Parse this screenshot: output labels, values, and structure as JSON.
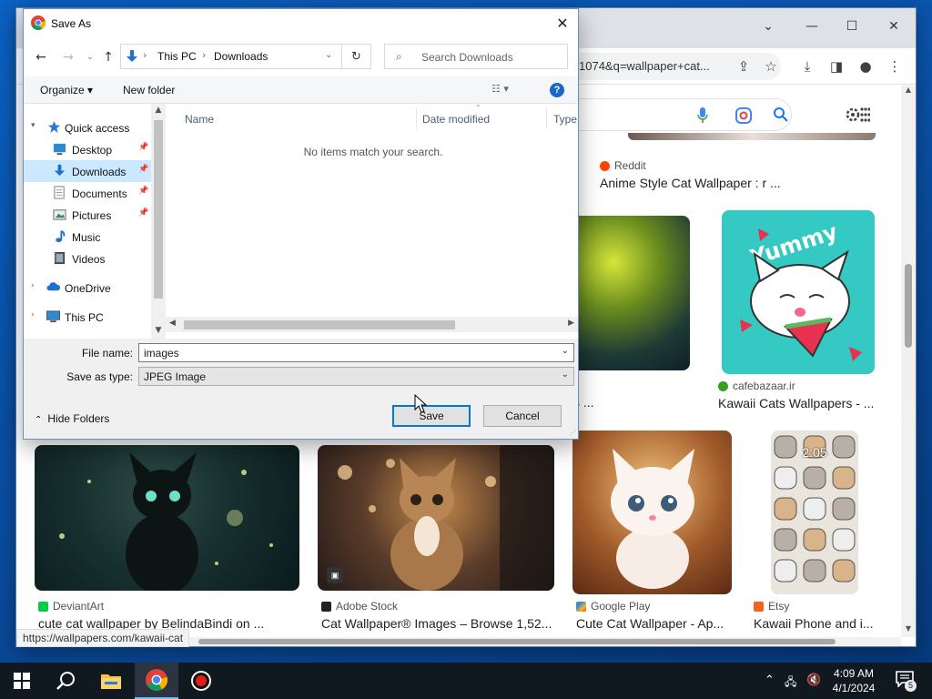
{
  "browser": {
    "omnibox_text": "1074&q=wallpaper+cat...",
    "window_controls": [
      "minimize-icon",
      "maximize-icon",
      "close-icon"
    ],
    "status_url": "https://wallpapers.com/kawaii-cat"
  },
  "results": [
    {
      "source": "Reddit",
      "source_color": "#ff4500",
      "caption": "Anime Style Cat Wallpaper : r ..."
    },
    {
      "source": "",
      "caption": "s ..."
    },
    {
      "source": "cafebazaar.ir",
      "source_color": "#3a9d23",
      "caption": "Kawaii Cats Wallpapers - ..."
    },
    {
      "source": "DeviantArt",
      "source_color": "#05cc47",
      "caption": "cute cat wallpaper by BelindaBindi on ..."
    },
    {
      "source": "Adobe Stock",
      "source_color": "#222222",
      "caption": "Cat Wallpaper® Images – Browse 1,52..."
    },
    {
      "source": "Google Play",
      "source_color": "#34a853",
      "caption": "Cute Cat Wallpaper - Ap..."
    },
    {
      "source": "Etsy",
      "source_color": "#f1641e",
      "caption": "Kawaii Phone and i..."
    }
  ],
  "image_overlay_text": "2:05",
  "dialog": {
    "title": "Save As",
    "breadcrumb": [
      "This PC",
      "Downloads"
    ],
    "search_placeholder": "Search Downloads",
    "organize_label": "Organize ▾",
    "new_folder_label": "New folder",
    "help_label": "?",
    "nav_items": [
      {
        "label": "Quick access",
        "icon": "star-icon",
        "expanded": true
      },
      {
        "label": "Desktop",
        "icon": "desktop-folder-icon",
        "pinned": true
      },
      {
        "label": "Downloads",
        "icon": "downloads-folder-icon",
        "pinned": true,
        "selected": true
      },
      {
        "label": "Documents",
        "icon": "documents-folder-icon",
        "pinned": true
      },
      {
        "label": "Pictures",
        "icon": "pictures-folder-icon",
        "pinned": true
      },
      {
        "label": "Music",
        "icon": "music-icon"
      },
      {
        "label": "Videos",
        "icon": "videos-icon"
      },
      {
        "label": "OneDrive",
        "icon": "cloud-icon",
        "expanded": false
      },
      {
        "label": "This PC",
        "icon": "computer-icon",
        "expanded": false
      }
    ],
    "columns": [
      "Name",
      "Date modified",
      "Type"
    ],
    "empty_message": "No items match your search.",
    "file_name_label": "File name:",
    "file_name_value": "images",
    "save_type_label": "Save as type:",
    "save_type_value": "JPEG Image",
    "hide_folders_label": "Hide Folders",
    "save_button": "Save",
    "cancel_button": "Cancel"
  },
  "taskbar": {
    "apps": [
      "start-icon",
      "search-icon",
      "file-explorer-icon",
      "chrome-icon",
      "recorder-icon"
    ],
    "time": "4:09 AM",
    "date": "4/1/2024",
    "notification_count": "5"
  }
}
